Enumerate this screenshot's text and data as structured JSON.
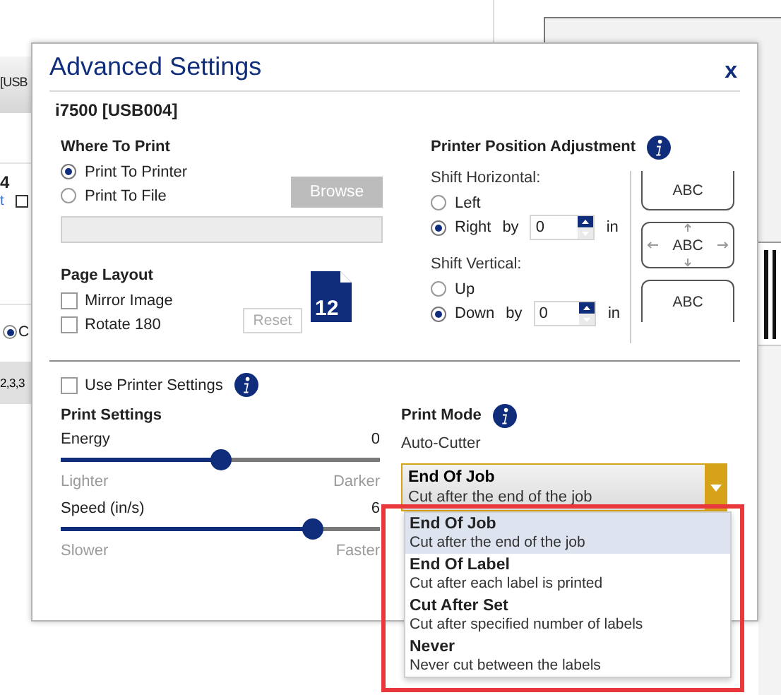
{
  "background": {
    "tab_label": "[USB",
    "item_title": "4",
    "item_link": "t",
    "item_checked": false,
    "radio_label": "C",
    "radio_selected": true,
    "button_label": "2,3,3"
  },
  "dialog": {
    "title": "Advanced Settings",
    "close": "x",
    "printer": "i7500 [USB004]",
    "where_to_print": {
      "heading": "Where To Print",
      "options": [
        {
          "label": "Print To Printer",
          "selected": true
        },
        {
          "label": "Print To File",
          "selected": false
        }
      ],
      "browse": {
        "label": "Browse",
        "disabled": true
      }
    },
    "page_layout": {
      "heading": "Page Layout",
      "options": [
        {
          "label": "Mirror Image",
          "checked": false
        },
        {
          "label": "Rotate 180",
          "checked": false
        }
      ],
      "reset": {
        "label": "Reset",
        "disabled": true
      },
      "preview_number": "12"
    },
    "position": {
      "heading": "Printer Position Adjustment",
      "shifts": [
        {
          "label": "Shift Horizontal:",
          "options": [
            {
              "label": "Left",
              "selected": false
            },
            {
              "label": "Right",
              "selected": true
            }
          ],
          "by": "by",
          "value": "0",
          "unit": "in"
        },
        {
          "label": "Shift Vertical:",
          "options": [
            {
              "label": "Up",
              "selected": false
            },
            {
              "label": "Down",
              "selected": true
            }
          ],
          "by": "by",
          "value": "0",
          "unit": "in"
        }
      ],
      "previews": [
        {
          "label": "ABC",
          "kind": "top"
        },
        {
          "label": "ABC",
          "kind": "center"
        },
        {
          "label": "ABC",
          "kind": "bottom"
        }
      ]
    },
    "use_printer_settings": {
      "label": "Use Printer Settings",
      "checked": false
    },
    "print_settings": {
      "heading": "Print Settings",
      "sliders": [
        {
          "label": "Energy",
          "reading": "0",
          "level": 0.5,
          "min_label": "Lighter",
          "max_label": "Darker"
        },
        {
          "label": "Speed (in/s)",
          "reading": "6",
          "level": 0.81,
          "min_label": "Slower",
          "max_label": "Faster"
        }
      ]
    },
    "print_mode": {
      "heading": "Print Mode",
      "sublabel": "Auto-Cutter",
      "dropdown": {
        "title": "End Of Job",
        "description": "Cut after the end of the job",
        "expanded": true
      },
      "options": [
        {
          "title": "End Of Job",
          "description": "Cut after the end of the job",
          "selected": true
        },
        {
          "title": "End Of Label",
          "description": "Cut after each label is printed",
          "selected": false
        },
        {
          "title": "Cut After Set",
          "description": "Cut after specified number of labels",
          "selected": false
        },
        {
          "title": "Never",
          "description": "Never cut between the labels",
          "selected": false
        }
      ]
    }
  }
}
